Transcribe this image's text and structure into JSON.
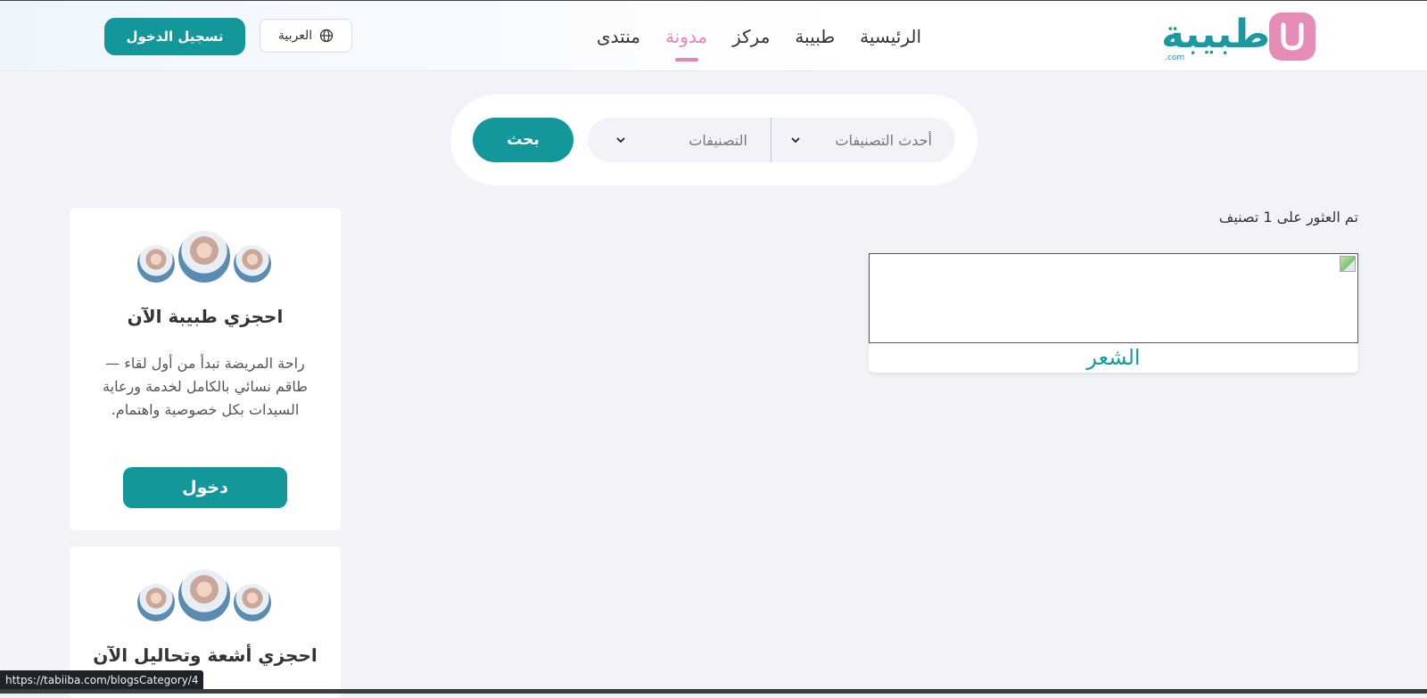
{
  "header": {
    "logo_text": "طبيبة",
    "logo_suffix": ".com",
    "nav": [
      {
        "label": "الرئيسية",
        "active": false
      },
      {
        "label": "طبيبة",
        "active": false
      },
      {
        "label": "مركز",
        "active": false
      },
      {
        "label": "مدونة",
        "active": true
      },
      {
        "label": "منتدى",
        "active": false
      }
    ],
    "language_label": "العربية",
    "login_label": "تسجيل الدخول"
  },
  "search": {
    "sort_select": "أحدث التصنيفات",
    "category_select": "التصنيفات",
    "button_label": "بحث"
  },
  "results": {
    "count_text": "تم العثور على 1 تصنيف",
    "categories": [
      {
        "title": "الشعر"
      }
    ]
  },
  "sidebar": {
    "cards": [
      {
        "title": "احجزي طبيبة الآن",
        "description": "راحة المريضة تبدأ من أول لقاء — طاقم نسائي بالكامل لخدمة ورعاية السيدات بكل خصوصية واهتمام.",
        "button_label": "دخول"
      },
      {
        "title": "احجزي أشعة وتحاليل الآن"
      }
    ]
  },
  "status_bar": {
    "url": "https://tabiiba.com/blogsCategory/4"
  },
  "colors": {
    "primary": "#14979b",
    "accent_pink": "#e884b2",
    "background": "#f1f3f9"
  }
}
